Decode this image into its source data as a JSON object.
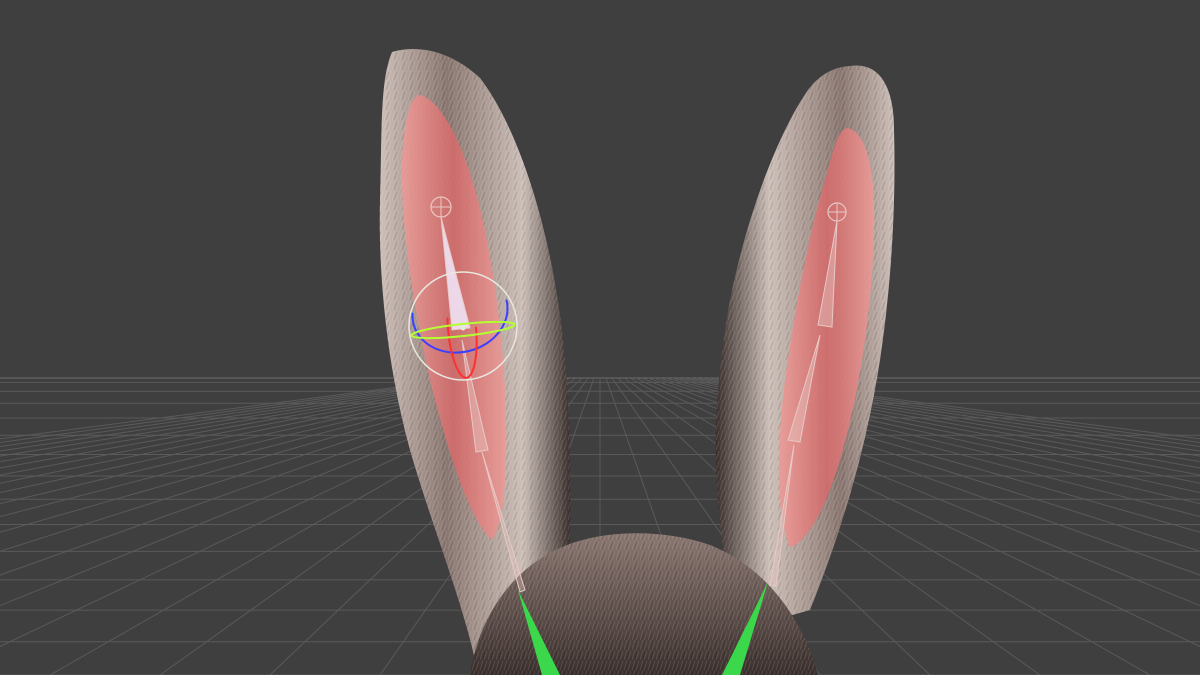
{
  "viewport": {
    "background_color": "#3f3f3f",
    "grid_line_color": "#5a5a5a",
    "horizon_line_color": "#6e6e6e"
  },
  "model": {
    "fur_outer_color": "#8a7670",
    "fur_highlight_color": "#cdbfb8",
    "fur_shadow_color": "#3a2f2c",
    "inner_ear_color": "#d66a6a",
    "inner_ear_highlight_color": "#ee9a96"
  },
  "rig": {
    "bone_color": "#e8c8c4",
    "neck_bone_color": "#3ad84a",
    "gizmo_x_axis_color": "#ff3030",
    "gizmo_y_axis_color": "#b4ff30",
    "gizmo_z_axis_color": "#3a40ff",
    "gizmo_ring_color": "#e8e8e0",
    "selected_bone_color": "#f2eaff"
  }
}
